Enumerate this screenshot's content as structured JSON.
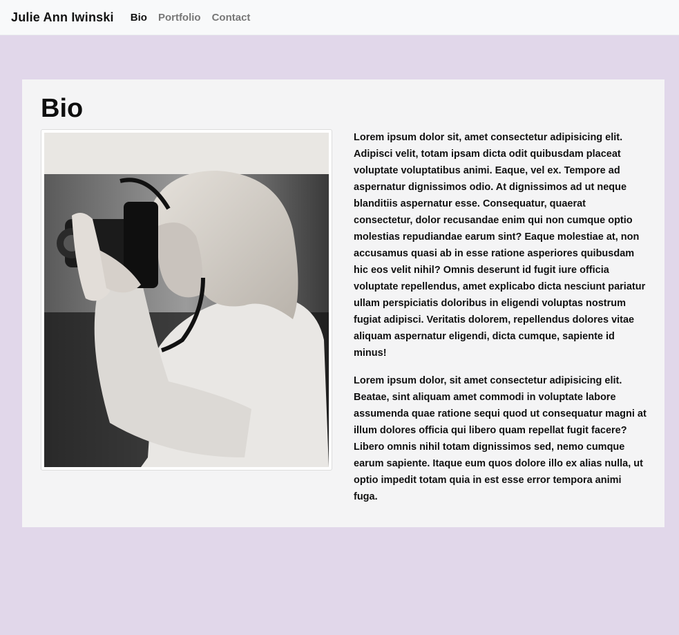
{
  "nav": {
    "brand": "Julie Ann Iwinski",
    "links": [
      {
        "label": "Bio",
        "active": true
      },
      {
        "label": "Portfolio",
        "active": false
      },
      {
        "label": "Contact",
        "active": false
      }
    ]
  },
  "main": {
    "title": "Bio",
    "paragraphs": [
      "Lorem ipsum dolor sit, amet consectetur adipisicing elit. Adipisci velit, totam ipsam dicta odit quibusdam placeat voluptate voluptatibus animi. Eaque, vel ex. Tempore ad aspernatur dignissimos odio. At dignissimos ad ut neque blanditiis aspernatur esse. Consequatur, quaerat consectetur, dolor recusandae enim qui non cumque optio molestias repudiandae earum sint? Eaque molestiae at, non accusamus quasi ab in esse ratione asperiores quibusdam hic eos velit nihil? Omnis deserunt id fugit iure officia voluptate repellendus, amet explicabo dicta nesciunt pariatur ullam perspiciatis doloribus in eligendi voluptas nostrum fugiat adipisci. Veritatis dolorem, repellendus dolores vitae aliquam aspernatur eligendi, dicta cumque, sapiente id minus!",
      "Lorem ipsum dolor, sit amet consectetur adipisicing elit. Beatae, sint aliquam amet commodi in voluptate labore assumenda quae ratione sequi quod ut consequatur magni at illum dolores officia qui libero quam repellat fugit facere? Libero omnis nihil totam dignissimos sed, nemo cumque earum sapiente. Itaque eum quos dolore illo ex alias nulla, ut optio impedit totam quia in est esse error tempora animi fuga."
    ]
  },
  "colors": {
    "page_background": "#e1d7ea",
    "navbar_background": "#f8f9fa",
    "card_background": "#f4f4f5",
    "nav_active": "#111111",
    "nav_inactive": "#777777"
  }
}
